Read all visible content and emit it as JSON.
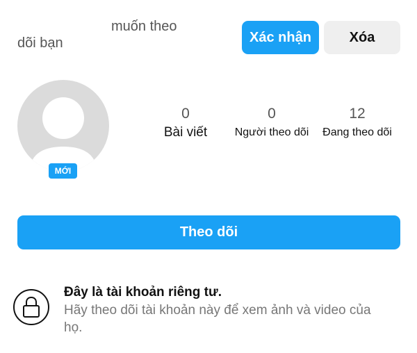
{
  "request": {
    "text_line1": "muốn theo",
    "text_line2": "dõi bạn",
    "confirm_label": "Xác nhận",
    "delete_label": "Xóa"
  },
  "profile": {
    "avatar_icon": "default-avatar-icon",
    "new_badge": "MỚI"
  },
  "stats": {
    "posts": {
      "count": "0",
      "label": "Bài viết"
    },
    "followers": {
      "count": "0",
      "label": "Người theo dõi"
    },
    "following": {
      "count": "12",
      "label": "Đang theo dõi"
    }
  },
  "follow_button_label": "Theo dõi",
  "private_notice": {
    "icon": "lock-icon",
    "title": "Đây là tài khoản riêng tư.",
    "description": "Hãy theo dõi tài khoản này để xem ảnh và video của họ."
  },
  "colors": {
    "accent": "#1aa1f5",
    "secondary_button": "#efefef",
    "avatar_placeholder": "#dbdbdb"
  }
}
